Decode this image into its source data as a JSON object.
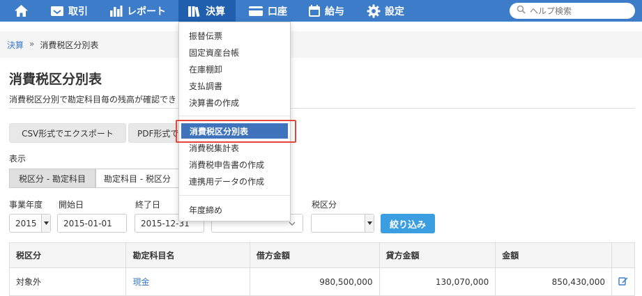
{
  "nav": {
    "items": [
      {
        "label": "",
        "icon": "home-icon"
      },
      {
        "label": "取引",
        "icon": "inbox-icon"
      },
      {
        "label": "レポート",
        "icon": "bar-chart-icon"
      },
      {
        "label": "決算",
        "icon": "books-icon"
      },
      {
        "label": "口座",
        "icon": "card-icon"
      },
      {
        "label": "給与",
        "icon": "calendar-icon"
      },
      {
        "label": "設定",
        "icon": "gear-icon"
      }
    ],
    "search_placeholder": "ヘルプ検索"
  },
  "breadcrumb": {
    "parent": "決算",
    "separator": "»",
    "current": "消費税区分別表"
  },
  "page": {
    "title": "消費税区分別表",
    "description": "消費税区分別で勘定科目毎の残高が確認でき",
    "csv_button": "CSV形式でエクスポート",
    "pdf_button": "PDF形式で",
    "display_label": "表示",
    "seg_a": "税区分 - 勘定科目",
    "seg_b": "勘定科目 - 税区分"
  },
  "filters": {
    "fiscal_year_label": "事業年度",
    "fiscal_year_value": "2015",
    "start_label": "開始日",
    "start_value": "2015-01-01",
    "end_label": "終了日",
    "end_value": "2015-12-31",
    "tax_label": "税区分",
    "tax_value": "",
    "submit": "絞り込み"
  },
  "table": {
    "headers": [
      "税区分",
      "勘定科目名",
      "借方金額",
      "貸方金額",
      "金額"
    ],
    "rows": [
      {
        "tax": "対象外",
        "account": "現金",
        "debit": "980,500,000",
        "credit": "130,070,000",
        "amount": "850,430,000"
      }
    ]
  },
  "menu": {
    "group1": [
      "振替伝票",
      "固定資産台帳",
      "在庫棚卸",
      "支払調書",
      "決算書の作成"
    ],
    "group2": [
      "消費税区分別表",
      "消費税集計表",
      "消費税申告書の作成",
      "連携用データの作成"
    ],
    "group3": [
      "年度締め"
    ]
  },
  "colors": {
    "navbar": "#3d7cc9",
    "active_nav": "#1f5fae",
    "link": "#3a7bc8",
    "primary": "#3a9ee0",
    "highlight_box": "#e4463a"
  }
}
